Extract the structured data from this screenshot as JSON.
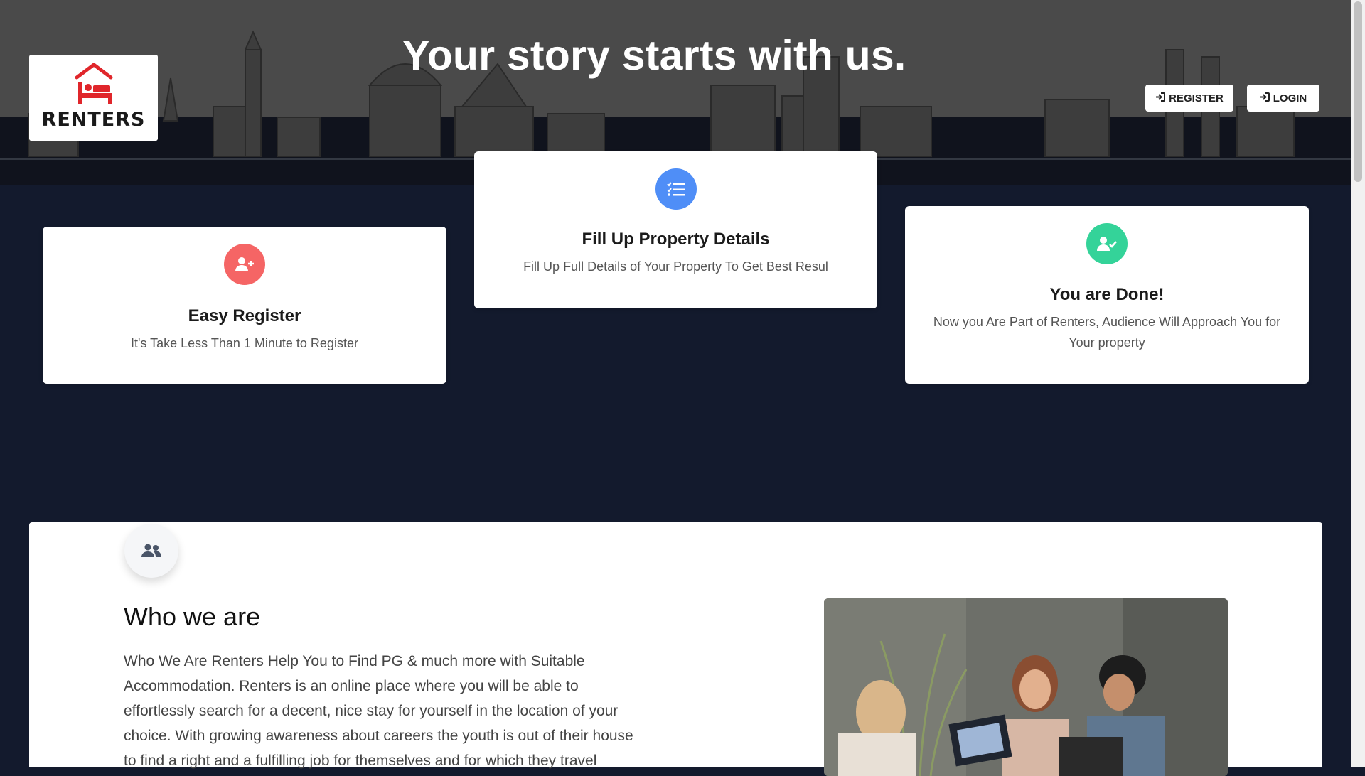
{
  "hero": {
    "title": "Your story starts with us.",
    "logo_text": "RENTERS",
    "register_label": "REGISTER",
    "login_label": "LOGIN"
  },
  "steps": [
    {
      "title": "Easy Register",
      "text": "It's Take Less Than 1 Minute to Register",
      "icon": "user-plus-icon",
      "color": "#f56565"
    },
    {
      "title": "Fill Up Property Details",
      "text": "Fill Up Full Details of Your Property To Get Best Resul",
      "icon": "list-check-icon",
      "color": "#4f8ef7"
    },
    {
      "title": "You are Done!",
      "text": "Now you Are Part of Renters, Audience Will Approach You for Your property",
      "icon": "user-check-icon",
      "color": "#34d399"
    }
  ],
  "about": {
    "title": "Who we are",
    "text": "Who We Are Renters Help You to Find PG & much more with Suitable Accommodation. Renters is an online place where you will be able to effortlessly search for a decent, nice stay for yourself in the location of your choice. With growing awareness about careers the youth is out of their house to find a right and a fulfilling job for themselves and for which they travel",
    "icon": "users-icon"
  },
  "colors": {
    "page_bg": "#131a2d",
    "hero_bg": "#4a4a4a",
    "logo_red": "#e0262b"
  }
}
